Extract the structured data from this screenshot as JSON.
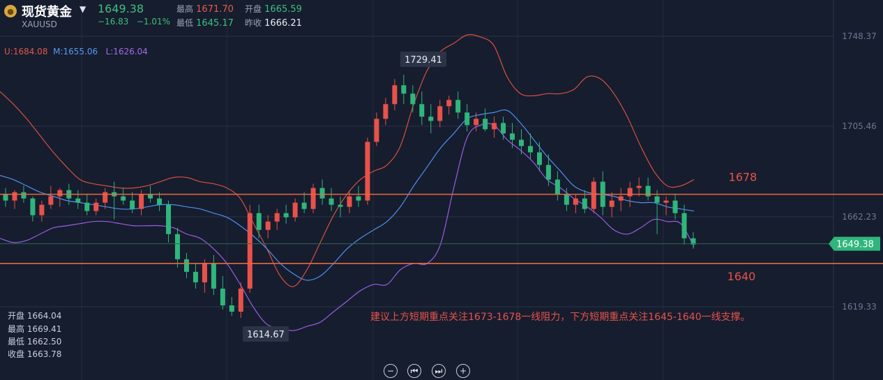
{
  "header": {
    "title": "现货黄金",
    "symbol": "XAUUSD",
    "price": "1649.38",
    "change": "−16.83",
    "change_pct": "−1.01%",
    "high_label": "最高",
    "high": "1671.70",
    "low_label": "最低",
    "low": "1645.17",
    "open_label": "开盘",
    "open": "1665.59",
    "prev_close_label": "昨收",
    "prev_close": "1666.21"
  },
  "indicators": {
    "upper": "U:1684.08",
    "mid": "M:1655.06",
    "lower": "L:1626.04"
  },
  "ohlc_panel": {
    "open": "开盘 1664.04",
    "high": "最高 1669.41",
    "low": "最低 1662.50",
    "close": "收盘 1663.78"
  },
  "annotations": {
    "peak": "1729.41",
    "trough": "1614.67",
    "resistance": "1678",
    "support": "1640",
    "note": "建议上方短期重点关注1673-1678一线阻力，下方短期重点关注1645-1640一线支撑。"
  },
  "colors": {
    "background": "#161d2e",
    "up": "#e8524a",
    "down": "#2fb67c",
    "upper_band": "#d8503f",
    "mid_band": "#4e8ff0",
    "lower_band": "#9b5ce6",
    "level_line": "#e86a42",
    "price_tag": "#2fb67c"
  },
  "chart_data": {
    "type": "candlestick",
    "y_ticks": [
      1748.37,
      1705.46,
      1662.23,
      1619.33
    ],
    "ylim": [
      1608,
      1757
    ],
    "current_price": 1649.38,
    "resistance_level": 1673,
    "support_level": 1640,
    "bollinger": {
      "upper": [
        1722,
        1716,
        1709,
        1701,
        1693,
        1686,
        1680,
        1678,
        1677,
        1676,
        1676,
        1677,
        1679,
        1681,
        1681,
        1679,
        1678,
        1676,
        1671,
        1659,
        1647,
        1634,
        1629,
        1637,
        1650,
        1663,
        1673,
        1680,
        1684,
        1687,
        1696,
        1716,
        1732,
        1741,
        1745,
        1749,
        1748,
        1744,
        1729,
        1721,
        1720,
        1721,
        1721,
        1723,
        1729,
        1728,
        1721,
        1710,
        1696,
        1684,
        1677,
        1677,
        1680
      ],
      "mid": [
        1682,
        1680,
        1677,
        1674,
        1672,
        1670,
        1669,
        1668,
        1667,
        1666,
        1666,
        1667,
        1668,
        1668,
        1667,
        1666,
        1664,
        1662,
        1658,
        1653,
        1647,
        1640,
        1635,
        1632,
        1634,
        1640,
        1647,
        1652,
        1656,
        1660,
        1667,
        1677,
        1686,
        1695,
        1702,
        1709,
        1711,
        1712,
        1713,
        1707,
        1699,
        1691,
        1684,
        1677,
        1674,
        1673,
        1672,
        1670,
        1669,
        1669,
        1667,
        1666,
        1665
      ],
      "lower": [
        1652,
        1650,
        1651,
        1654,
        1657,
        1658,
        1659,
        1660,
        1660,
        1659,
        1658,
        1658,
        1658,
        1657,
        1654,
        1652,
        1647,
        1640,
        1630,
        1619,
        1611,
        1609,
        1608,
        1610,
        1612,
        1617,
        1622,
        1627,
        1630,
        1630,
        1637,
        1640,
        1640,
        1649,
        1676,
        1700,
        1706,
        1706,
        1699,
        1694,
        1688,
        1680,
        1676,
        1671,
        1667,
        1662,
        1656,
        1654,
        1657,
        1661,
        1660,
        1659,
        1648
      ]
    },
    "candles_ohlc": [
      [
        1673,
        1676,
        1667,
        1670
      ],
      [
        1670,
        1675,
        1666,
        1674
      ],
      [
        1674,
        1677,
        1669,
        1671
      ],
      [
        1671,
        1672,
        1660,
        1663
      ],
      [
        1663,
        1670,
        1660,
        1668
      ],
      [
        1668,
        1677,
        1666,
        1672
      ],
      [
        1672,
        1676,
        1667,
        1675
      ],
      [
        1675,
        1678,
        1668,
        1671
      ],
      [
        1671,
        1675,
        1666,
        1669
      ],
      [
        1669,
        1673,
        1663,
        1665
      ],
      [
        1665,
        1671,
        1663,
        1669
      ],
      [
        1669,
        1676,
        1666,
        1674
      ],
      [
        1674,
        1679,
        1661,
        1672
      ],
      [
        1672,
        1676,
        1668,
        1670
      ],
      [
        1670,
        1674,
        1664,
        1666
      ],
      [
        1666,
        1675,
        1663,
        1673
      ],
      [
        1673,
        1677,
        1669,
        1671
      ],
      [
        1671,
        1674,
        1665,
        1668
      ],
      [
        1668,
        1670,
        1650,
        1654
      ],
      [
        1654,
        1657,
        1638,
        1642
      ],
      [
        1642,
        1645,
        1633,
        1636
      ],
      [
        1636,
        1640,
        1628,
        1631
      ],
      [
        1631,
        1642,
        1626,
        1640
      ],
      [
        1640,
        1644,
        1625,
        1628
      ],
      [
        1628,
        1634,
        1618,
        1620
      ],
      [
        1620,
        1624,
        1615,
        1617
      ],
      [
        1617,
        1631,
        1614,
        1628
      ],
      [
        1628,
        1668,
        1626,
        1664
      ],
      [
        1664,
        1668,
        1652,
        1656
      ],
      [
        1656,
        1663,
        1652,
        1660
      ],
      [
        1660,
        1666,
        1656,
        1664
      ],
      [
        1664,
        1668,
        1659,
        1662
      ],
      [
        1662,
        1671,
        1660,
        1669
      ],
      [
        1669,
        1674,
        1664,
        1666
      ],
      [
        1666,
        1678,
        1664,
        1676
      ],
      [
        1676,
        1680,
        1668,
        1671
      ],
      [
        1671,
        1676,
        1665,
        1668
      ],
      [
        1668,
        1672,
        1662,
        1667
      ],
      [
        1667,
        1675,
        1664,
        1672
      ],
      [
        1672,
        1677,
        1667,
        1670
      ],
      [
        1670,
        1700,
        1668,
        1698
      ],
      [
        1698,
        1712,
        1696,
        1709
      ],
      [
        1709,
        1719,
        1706,
        1716
      ],
      [
        1716,
        1728,
        1713,
        1725
      ],
      [
        1725,
        1730,
        1716,
        1721
      ],
      [
        1721,
        1725,
        1712,
        1716
      ],
      [
        1716,
        1722,
        1706,
        1710
      ],
      [
        1710,
        1716,
        1702,
        1708
      ],
      [
        1708,
        1718,
        1705,
        1715
      ],
      [
        1715,
        1720,
        1711,
        1718
      ],
      [
        1718,
        1722,
        1709,
        1712
      ],
      [
        1712,
        1716,
        1703,
        1706
      ],
      [
        1706,
        1712,
        1703,
        1709
      ],
      [
        1709,
        1714,
        1703,
        1704
      ],
      [
        1704,
        1710,
        1700,
        1707
      ],
      [
        1707,
        1710,
        1699,
        1702
      ],
      [
        1702,
        1707,
        1695,
        1699
      ],
      [
        1699,
        1704,
        1692,
        1696
      ],
      [
        1696,
        1702,
        1690,
        1693
      ],
      [
        1693,
        1698,
        1684,
        1687
      ],
      [
        1687,
        1692,
        1677,
        1680
      ],
      [
        1680,
        1684,
        1670,
        1673
      ],
      [
        1673,
        1676,
        1665,
        1668
      ],
      [
        1668,
        1673,
        1664,
        1671
      ],
      [
        1671,
        1675,
        1664,
        1666
      ],
      [
        1666,
        1681,
        1664,
        1679
      ],
      [
        1679,
        1684,
        1663,
        1667
      ],
      [
        1667,
        1674,
        1662,
        1670
      ],
      [
        1670,
        1676,
        1665,
        1672
      ],
      [
        1672,
        1679,
        1667,
        1676
      ],
      [
        1676,
        1681,
        1672,
        1677
      ],
      [
        1677,
        1681,
        1670,
        1672
      ],
      [
        1672,
        1675,
        1654,
        1669
      ],
      [
        1669,
        1672,
        1663,
        1670
      ],
      [
        1670,
        1673,
        1661,
        1664
      ],
      [
        1664,
        1668,
        1649,
        1652
      ],
      [
        1652,
        1655,
        1647,
        1649
      ]
    ]
  }
}
